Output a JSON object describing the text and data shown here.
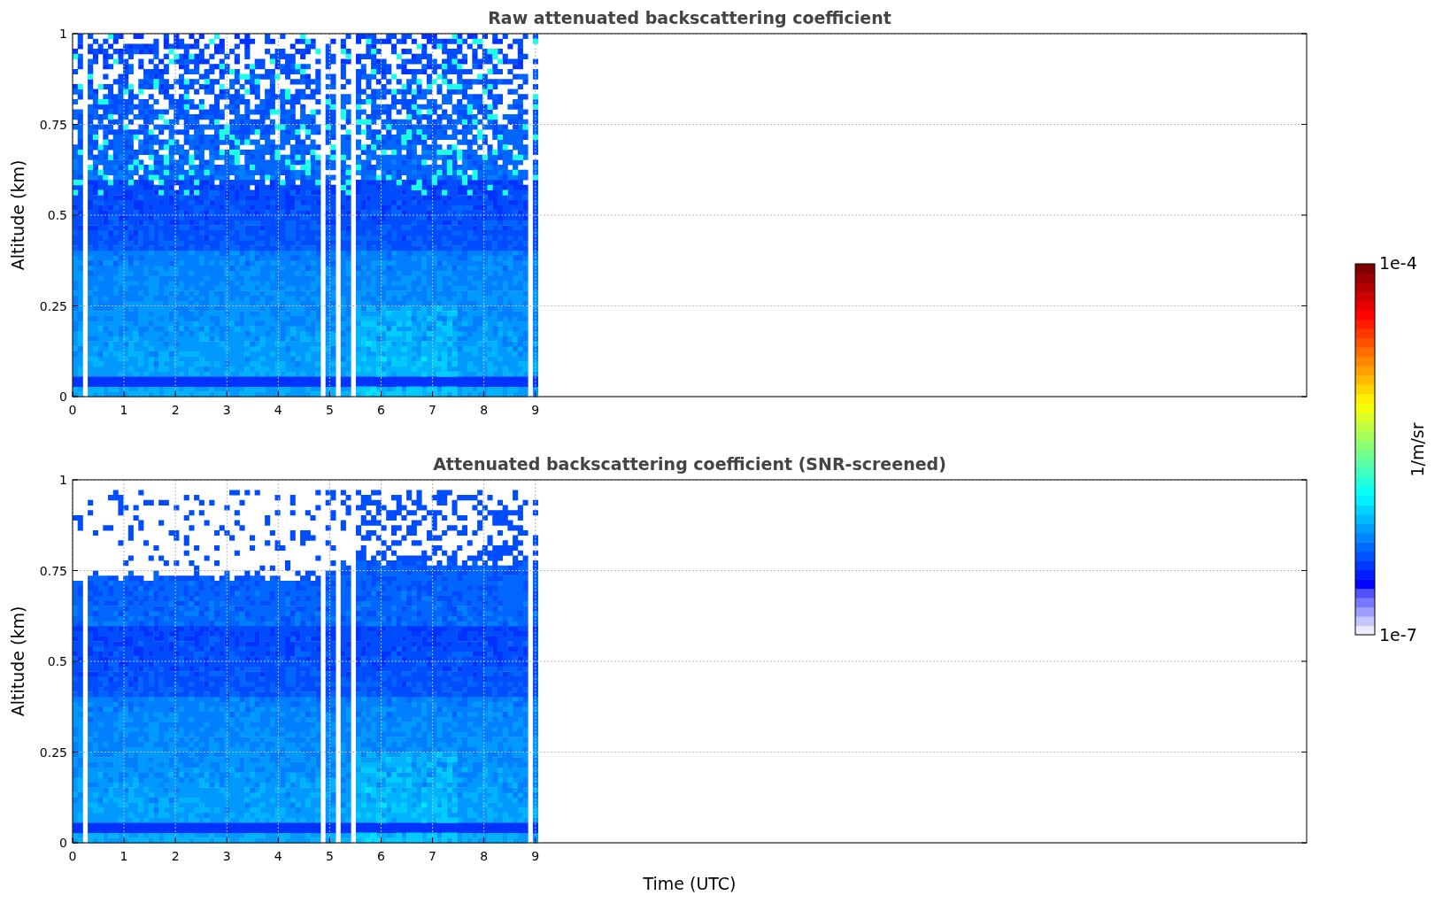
{
  "panels": [
    {
      "kind": "raw",
      "title": "Raw attenuated backscattering coefficient",
      "ylabel": "Altitude (km)",
      "yticks": [
        "1",
        "0.75",
        "0.5",
        "0.25",
        "0"
      ],
      "xticks": [
        "0",
        "1",
        "2",
        "3",
        "4",
        "5",
        "6",
        "7",
        "8",
        "9"
      ]
    },
    {
      "kind": "screened",
      "title": "Attenuated backscattering coefficient (SNR-screened)",
      "ylabel": "Altitude (km)",
      "yticks": [
        "1",
        "0.75",
        "0.5",
        "0.25",
        "0"
      ],
      "xticks": [
        "0",
        "1",
        "2",
        "3",
        "4",
        "5",
        "6",
        "7",
        "8",
        "9"
      ]
    }
  ],
  "xlabel": "Time (UTC)",
  "colorbar": {
    "max": "1e-4",
    "min": "1e-7",
    "label": "1/m/sr"
  }
}
